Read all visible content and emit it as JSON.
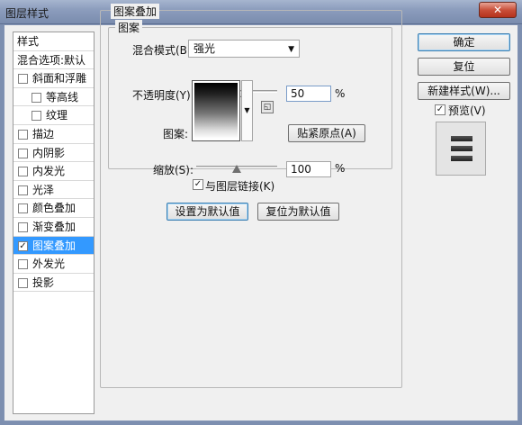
{
  "window": {
    "title": "图层样式"
  },
  "sidebar": {
    "items": [
      {
        "label": "样式",
        "checkbox": false,
        "checked": false,
        "indent": 0,
        "selected": false
      },
      {
        "label": "混合选项:默认",
        "checkbox": false,
        "checked": false,
        "indent": 0,
        "selected": false
      },
      {
        "label": "斜面和浮雕",
        "checkbox": true,
        "checked": false,
        "indent": 0,
        "selected": false
      },
      {
        "label": "等高线",
        "checkbox": true,
        "checked": false,
        "indent": 1,
        "selected": false
      },
      {
        "label": "纹理",
        "checkbox": true,
        "checked": false,
        "indent": 1,
        "selected": false
      },
      {
        "label": "描边",
        "checkbox": true,
        "checked": false,
        "indent": 0,
        "selected": false
      },
      {
        "label": "内阴影",
        "checkbox": true,
        "checked": false,
        "indent": 0,
        "selected": false
      },
      {
        "label": "内发光",
        "checkbox": true,
        "checked": false,
        "indent": 0,
        "selected": false
      },
      {
        "label": "光泽",
        "checkbox": true,
        "checked": false,
        "indent": 0,
        "selected": false
      },
      {
        "label": "颜色叠加",
        "checkbox": true,
        "checked": false,
        "indent": 0,
        "selected": false
      },
      {
        "label": "渐变叠加",
        "checkbox": true,
        "checked": false,
        "indent": 0,
        "selected": false
      },
      {
        "label": "图案叠加",
        "checkbox": true,
        "checked": true,
        "indent": 0,
        "selected": true
      },
      {
        "label": "外发光",
        "checkbox": true,
        "checked": false,
        "indent": 0,
        "selected": false
      },
      {
        "label": "投影",
        "checkbox": true,
        "checked": false,
        "indent": 0,
        "selected": false
      }
    ]
  },
  "panel": {
    "group_title": "图案叠加",
    "inner_title": "图案",
    "blend_mode_label": "混合模式(B):",
    "blend_mode_value": "强光",
    "opacity_label": "不透明度(Y):",
    "opacity_value": "50",
    "opacity_fraction": 0.5,
    "percent": "%",
    "pattern_label": "图案:",
    "snap_origin_label": "贴紧原点(A)",
    "scale_label": "缩放(S):",
    "scale_value": "100",
    "scale_fraction": 0.5,
    "link_label": "与图层链接(K)",
    "link_checked": true,
    "set_default_label": "设置为默认值",
    "reset_default_label": "复位为默认值"
  },
  "buttons": {
    "ok": "确定",
    "reset": "复位",
    "new_style": "新建样式(W)...",
    "preview_label": "预览(V)",
    "preview_checked": true
  },
  "icons": {
    "close": "close-icon",
    "dropdown": "chevron-down-icon",
    "check": "checkmark-icon"
  }
}
